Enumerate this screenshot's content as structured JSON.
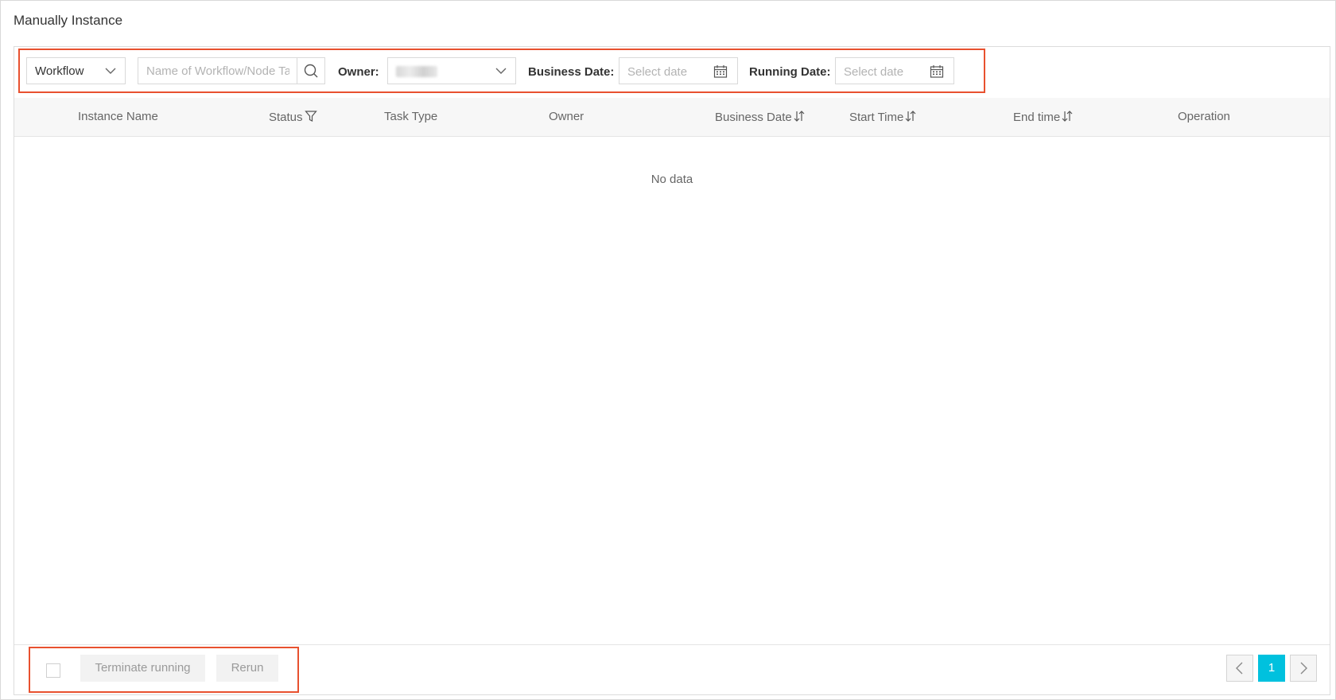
{
  "page_title": "Manually Instance",
  "filters": {
    "type_select": "Workflow",
    "search_placeholder": "Name of Workflow/Node Ta",
    "owner_label": "Owner:",
    "business_date_label": "Business Date:",
    "business_date_placeholder": "Select date",
    "running_date_label": "Running Date:",
    "running_date_placeholder": "Select date"
  },
  "table": {
    "columns": [
      "Instance Name",
      "Status",
      "Task Type",
      "Owner",
      "Business Date",
      "Start Time",
      "End time",
      "Operation"
    ],
    "empty_text": "No data"
  },
  "footer": {
    "terminate_label": "Terminate running",
    "rerun_label": "Rerun"
  },
  "pagination": {
    "current_page": "1"
  },
  "colors": {
    "highlight": "#e8512f",
    "accent": "#00c1de"
  }
}
